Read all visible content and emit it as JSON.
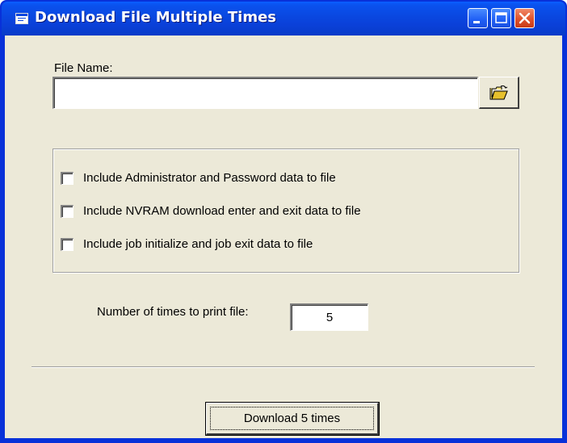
{
  "window": {
    "title": "Download File Multiple Times",
    "icon": "app-window-icon",
    "titlebar_color": "#0a47e0",
    "client_color": "#ece9d8",
    "controls": {
      "minimize_icon": "minimize-icon",
      "maximize_icon": "maximize-icon",
      "close_icon": "close-icon"
    }
  },
  "file": {
    "label": "File Name:",
    "value": "",
    "browse_icon": "open-folder-icon"
  },
  "options": [
    {
      "label": "Include Administrator and Password data to file",
      "checked": false
    },
    {
      "label": "Include NVRAM download enter and exit data to file",
      "checked": false
    },
    {
      "label": "Include job initialize and job exit data to file",
      "checked": false
    }
  ],
  "times": {
    "label": "Number of times to print file:",
    "value": "5"
  },
  "actions": {
    "download_label": "Download 5 times"
  }
}
